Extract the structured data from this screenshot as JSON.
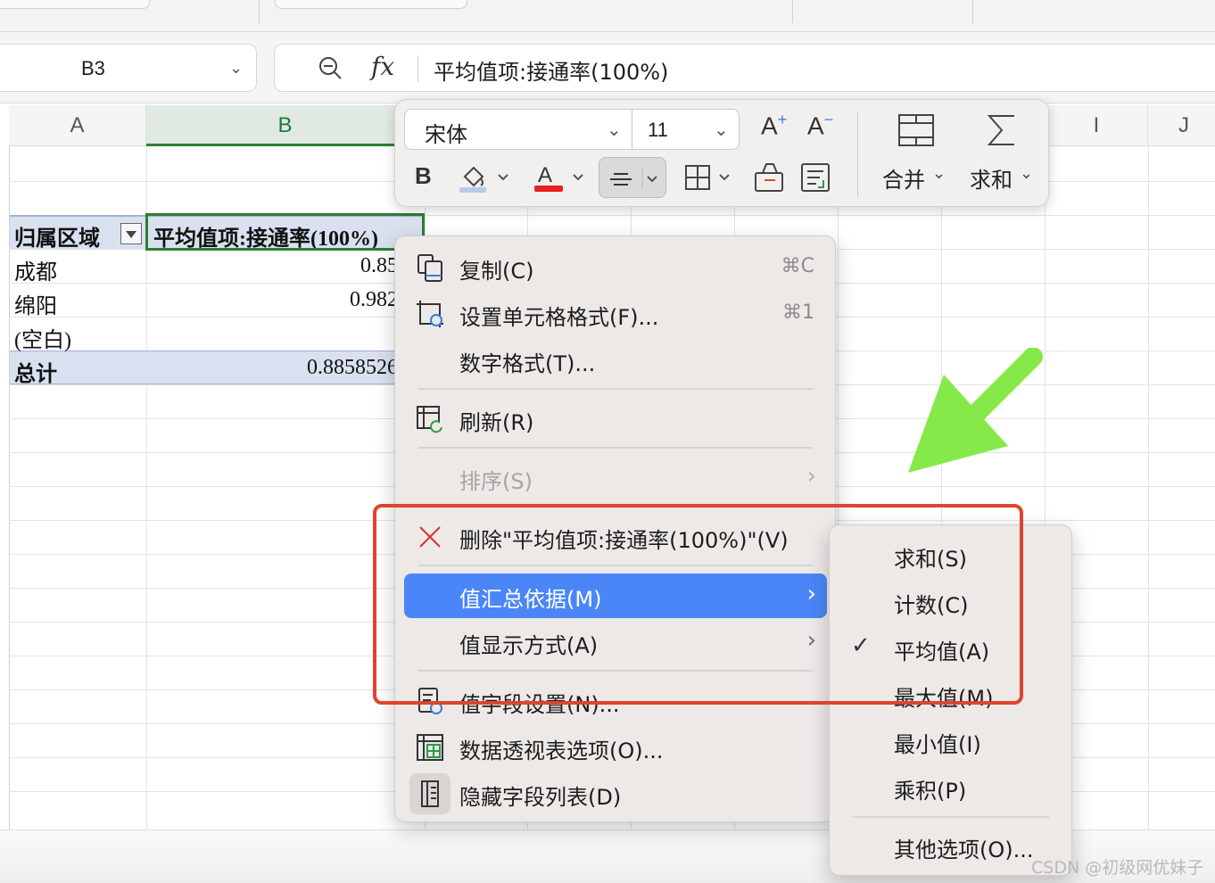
{
  "formula_bar": {
    "cell_ref": "B3",
    "formula_text": "平均值项:接通率(100%)"
  },
  "columns": [
    "A",
    "B",
    "I",
    "J"
  ],
  "pivot": {
    "header_col1": "归属区域",
    "header_col2": "平均值项:接通率(100%)",
    "rows": [
      {
        "label": "成都",
        "value": "0.85"
      },
      {
        "label": "绵阳",
        "value": "0.982"
      },
      {
        "label": "(空白)",
        "value": ""
      }
    ],
    "total_label": "总计",
    "total_value": "0.8858526"
  },
  "mini_toolbar": {
    "font_name": "宋体",
    "font_size": "11",
    "merge_label": "合并",
    "sum_label": "求和"
  },
  "context_menu": {
    "items": [
      {
        "label": "复制(C)",
        "shortcut": "⌘C",
        "icon": "copy-icon"
      },
      {
        "label": "设置单元格格式(F)...",
        "shortcut": "⌘1",
        "icon": "format-cells-icon"
      },
      {
        "label": "数字格式(T)..."
      },
      {
        "label": "刷新(R)",
        "icon": "refresh-icon"
      },
      {
        "label": "排序(S)",
        "disabled": true
      },
      {
        "label": "删除\"平均值项:接通率(100%)\"(V)",
        "icon": "delete-icon"
      },
      {
        "label": "值汇总依据(M)",
        "highlighted": true
      },
      {
        "label": "值显示方式(A)"
      },
      {
        "label": "值字段设置(N)...",
        "icon": "field-settings-icon"
      },
      {
        "label": "数据透视表选项(O)...",
        "icon": "pivot-options-icon"
      },
      {
        "label": "隐藏字段列表(D)",
        "icon": "field-list-icon"
      }
    ],
    "highlight_color": "#4a86f7"
  },
  "submenu": {
    "items": [
      {
        "label": "求和(S)"
      },
      {
        "label": "计数(C)"
      },
      {
        "label": "平均值(A)",
        "checked": true
      },
      {
        "label": "最大值(M)"
      },
      {
        "label": "最小值(I)"
      },
      {
        "label": "乘积(P)"
      },
      {
        "label": "其他选项(O)..."
      }
    ]
  },
  "annotation": {
    "box_color": "#e0442d",
    "arrow_color": "#86e94a"
  },
  "watermark": "CSDN @初级网优妹子"
}
